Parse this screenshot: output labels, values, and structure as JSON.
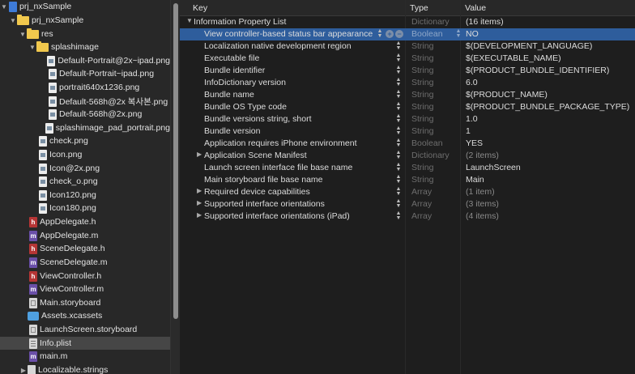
{
  "navigator": {
    "items": [
      {
        "label": "prj_nxSample",
        "icon": "project-icon"
      },
      {
        "label": "prj_nxSample",
        "icon": "folder-icon"
      },
      {
        "label": "res",
        "icon": "folder-icon"
      },
      {
        "label": "splashimage",
        "icon": "folder-icon"
      },
      {
        "label": "Default-Portrait@2x~ipad.png",
        "icon": "image-file-icon"
      },
      {
        "label": "Default-Portrait~ipad.png",
        "icon": "image-file-icon"
      },
      {
        "label": "portrait640x1236.png",
        "icon": "image-file-icon"
      },
      {
        "label": "Default-568h@2x 복사본.png",
        "icon": "image-file-icon"
      },
      {
        "label": "Default-568h@2x.png",
        "icon": "image-file-icon"
      },
      {
        "label": "splashimage_pad_portrait.png",
        "icon": "image-file-icon"
      },
      {
        "label": "check.png",
        "icon": "image-file-icon"
      },
      {
        "label": "Icon.png",
        "icon": "image-file-icon"
      },
      {
        "label": "Icon@2x.png",
        "icon": "image-file-icon"
      },
      {
        "label": "check_o.png",
        "icon": "image-file-icon"
      },
      {
        "label": "Icon120.png",
        "icon": "image-file-icon"
      },
      {
        "label": "Icon180.png",
        "icon": "image-file-icon"
      },
      {
        "label": "AppDelegate.h",
        "icon": "header-file-icon",
        "glyph": "h"
      },
      {
        "label": "AppDelegate.m",
        "icon": "implementation-file-icon",
        "glyph": "m"
      },
      {
        "label": "SceneDelegate.h",
        "icon": "header-file-icon",
        "glyph": "h"
      },
      {
        "label": "SceneDelegate.m",
        "icon": "implementation-file-icon",
        "glyph": "m"
      },
      {
        "label": "ViewController.h",
        "icon": "header-file-icon",
        "glyph": "h"
      },
      {
        "label": "ViewController.m",
        "icon": "implementation-file-icon",
        "glyph": "m"
      },
      {
        "label": "Main.storyboard",
        "icon": "storyboard-file-icon"
      },
      {
        "label": "Assets.xcassets",
        "icon": "asset-catalog-icon"
      },
      {
        "label": "LaunchScreen.storyboard",
        "icon": "storyboard-file-icon"
      },
      {
        "label": "Info.plist",
        "icon": "plist-file-icon"
      },
      {
        "label": "main.m",
        "icon": "implementation-file-icon",
        "glyph": "m"
      },
      {
        "label": "Localizable.strings",
        "icon": "strings-file-icon"
      }
    ]
  },
  "plist": {
    "headers": {
      "key": "Key",
      "type": "Type",
      "value": "Value"
    },
    "root": {
      "key": "Information Property List",
      "type": "Dictionary",
      "value": "(16 items)"
    },
    "rows": [
      {
        "key": "View controller-based status bar appearance",
        "type": "Boolean",
        "value": "NO"
      },
      {
        "key": "Localization native development region",
        "type": "String",
        "value": "$(DEVELOPMENT_LANGUAGE)"
      },
      {
        "key": "Executable file",
        "type": "String",
        "value": "$(EXECUTABLE_NAME)"
      },
      {
        "key": "Bundle identifier",
        "type": "String",
        "value": "$(PRODUCT_BUNDLE_IDENTIFIER)"
      },
      {
        "key": "InfoDictionary version",
        "type": "String",
        "value": "6.0"
      },
      {
        "key": "Bundle name",
        "type": "String",
        "value": "$(PRODUCT_NAME)"
      },
      {
        "key": "Bundle OS Type code",
        "type": "String",
        "value": "$(PRODUCT_BUNDLE_PACKAGE_TYPE)"
      },
      {
        "key": "Bundle versions string, short",
        "type": "String",
        "value": "1.0"
      },
      {
        "key": "Bundle version",
        "type": "String",
        "value": "1"
      },
      {
        "key": "Application requires iPhone environment",
        "type": "Boolean",
        "value": "YES"
      },
      {
        "key": "Application Scene Manifest",
        "type": "Dictionary",
        "value": "(2 items)"
      },
      {
        "key": "Launch screen interface file base name",
        "type": "String",
        "value": "LaunchScreen"
      },
      {
        "key": "Main storyboard file base name",
        "type": "String",
        "value": "Main"
      },
      {
        "key": "Required device capabilities",
        "type": "Array",
        "value": "(1 item)"
      },
      {
        "key": "Supported interface orientations",
        "type": "Array",
        "value": "(3 items)"
      },
      {
        "key": "Supported interface orientations (iPad)",
        "type": "Array",
        "value": "(4 items)"
      }
    ],
    "add_button_glyph": "+",
    "remove_button_glyph": "−"
  },
  "colors": {
    "selection": "#2e5d9c",
    "navigator_selection": "#464646",
    "folder": "#f1c84d"
  }
}
